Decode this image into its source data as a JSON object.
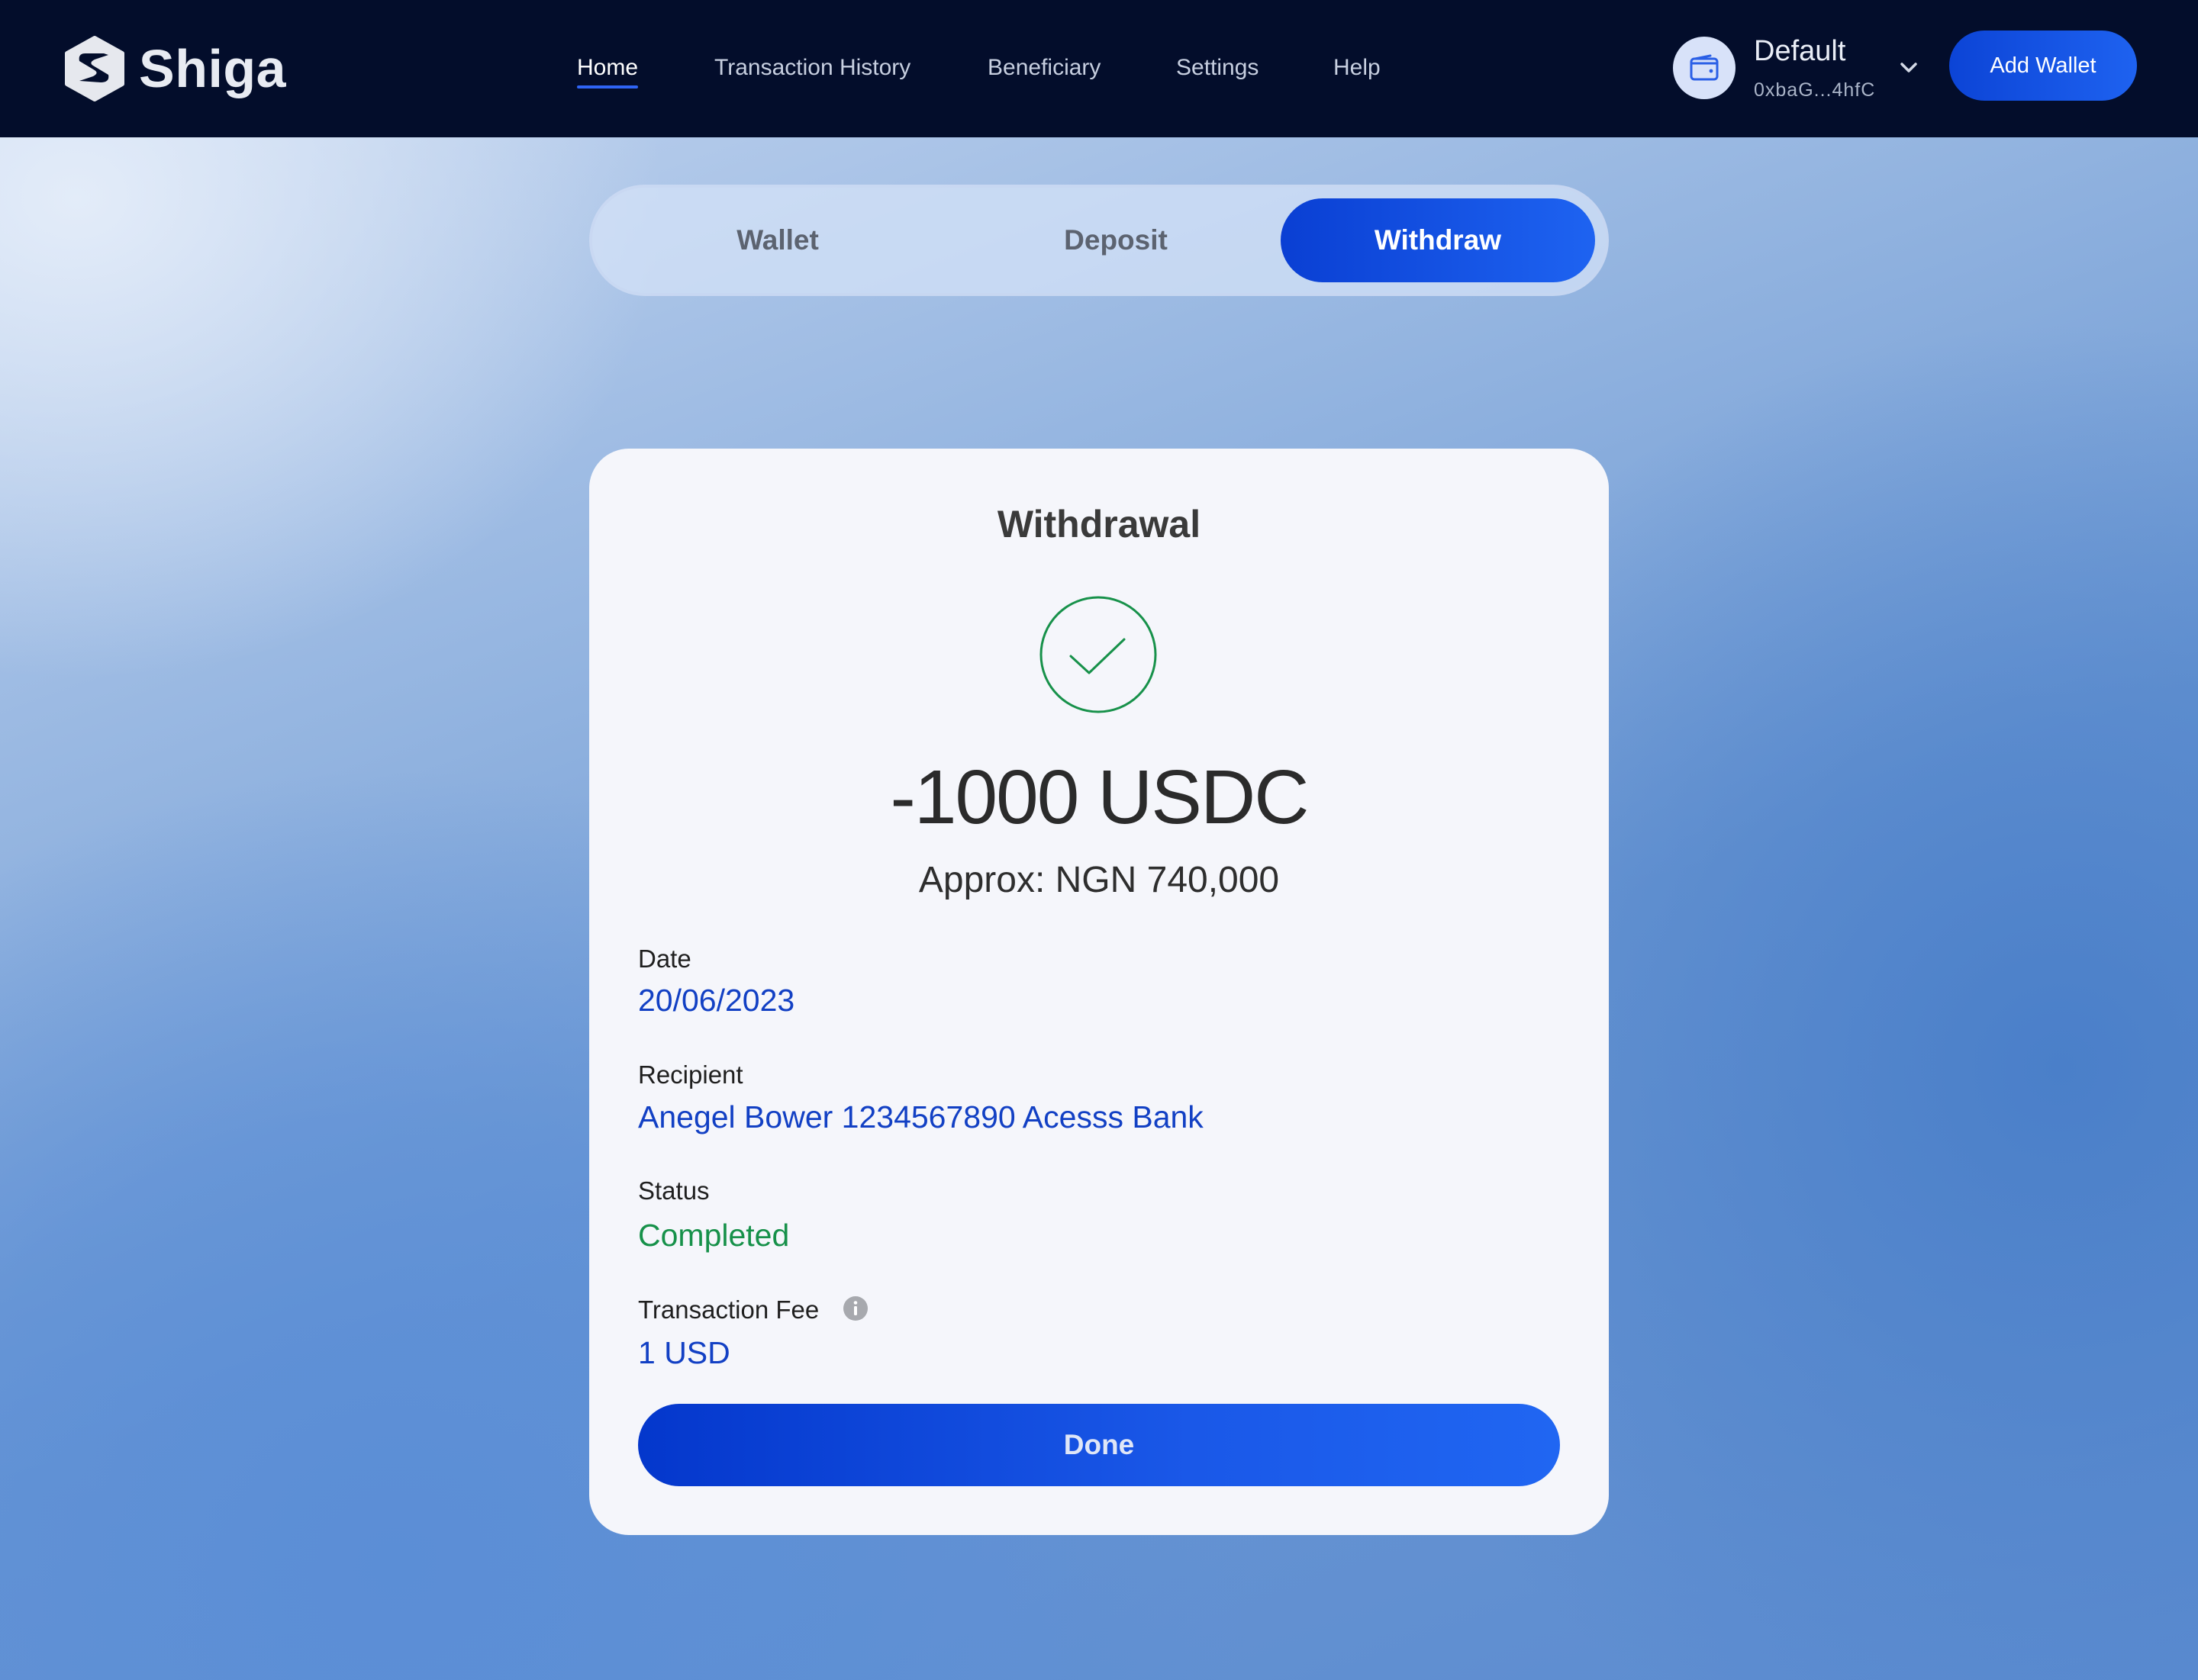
{
  "app": {
    "brand": "Shiga"
  },
  "nav": {
    "items": [
      {
        "label": "Home",
        "active": true
      },
      {
        "label": "Transaction History",
        "active": false
      },
      {
        "label": "Beneficiary",
        "active": false
      },
      {
        "label": "Settings",
        "active": false
      },
      {
        "label": "Help",
        "active": false
      }
    ]
  },
  "wallet": {
    "name": "Default",
    "address": "0xbaG...4hfC",
    "icon": "wallet-icon",
    "add_label": "Add Wallet"
  },
  "tabs": [
    {
      "label": "Wallet",
      "active": false
    },
    {
      "label": "Deposit",
      "active": false
    },
    {
      "label": "Withdraw",
      "active": true
    }
  ],
  "receipt": {
    "title": "Withdrawal",
    "status_icon": "check-circle-icon",
    "amount": "-1000 USDC",
    "approx": "Approx: NGN 740,000",
    "fields": {
      "date": {
        "label": "Date",
        "value": "20/06/2023"
      },
      "recipient": {
        "label": "Recipient",
        "value": "Anegel Bower 1234567890 Acesss  Bank"
      },
      "status": {
        "label": "Status",
        "value": "Completed"
      },
      "fee": {
        "label": "Transaction Fee",
        "value": "1 USD",
        "icon": "info-icon"
      }
    },
    "done_label": "Done"
  },
  "colors": {
    "header_bg": "#030d2b",
    "accent": "#1e62f0",
    "link_blue": "#1240c4",
    "success_green": "#17914a"
  }
}
